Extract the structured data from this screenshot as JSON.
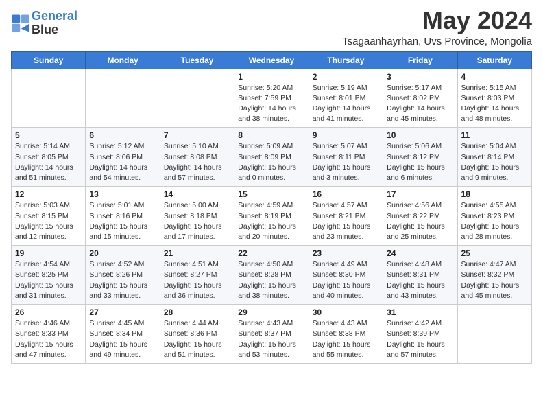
{
  "header": {
    "logo_line1": "General",
    "logo_line2": "Blue",
    "month": "May 2024",
    "location": "Tsagaanhayrhan, Uvs Province, Mongolia"
  },
  "weekdays": [
    "Sunday",
    "Monday",
    "Tuesday",
    "Wednesday",
    "Thursday",
    "Friday",
    "Saturday"
  ],
  "weeks": [
    [
      {
        "day": "",
        "info": ""
      },
      {
        "day": "",
        "info": ""
      },
      {
        "day": "",
        "info": ""
      },
      {
        "day": "1",
        "info": "Sunrise: 5:20 AM\nSunset: 7:59 PM\nDaylight: 14 hours\nand 38 minutes."
      },
      {
        "day": "2",
        "info": "Sunrise: 5:19 AM\nSunset: 8:01 PM\nDaylight: 14 hours\nand 41 minutes."
      },
      {
        "day": "3",
        "info": "Sunrise: 5:17 AM\nSunset: 8:02 PM\nDaylight: 14 hours\nand 45 minutes."
      },
      {
        "day": "4",
        "info": "Sunrise: 5:15 AM\nSunset: 8:03 PM\nDaylight: 14 hours\nand 48 minutes."
      }
    ],
    [
      {
        "day": "5",
        "info": "Sunrise: 5:14 AM\nSunset: 8:05 PM\nDaylight: 14 hours\nand 51 minutes."
      },
      {
        "day": "6",
        "info": "Sunrise: 5:12 AM\nSunset: 8:06 PM\nDaylight: 14 hours\nand 54 minutes."
      },
      {
        "day": "7",
        "info": "Sunrise: 5:10 AM\nSunset: 8:08 PM\nDaylight: 14 hours\nand 57 minutes."
      },
      {
        "day": "8",
        "info": "Sunrise: 5:09 AM\nSunset: 8:09 PM\nDaylight: 15 hours\nand 0 minutes."
      },
      {
        "day": "9",
        "info": "Sunrise: 5:07 AM\nSunset: 8:11 PM\nDaylight: 15 hours\nand 3 minutes."
      },
      {
        "day": "10",
        "info": "Sunrise: 5:06 AM\nSunset: 8:12 PM\nDaylight: 15 hours\nand 6 minutes."
      },
      {
        "day": "11",
        "info": "Sunrise: 5:04 AM\nSunset: 8:14 PM\nDaylight: 15 hours\nand 9 minutes."
      }
    ],
    [
      {
        "day": "12",
        "info": "Sunrise: 5:03 AM\nSunset: 8:15 PM\nDaylight: 15 hours\nand 12 minutes."
      },
      {
        "day": "13",
        "info": "Sunrise: 5:01 AM\nSunset: 8:16 PM\nDaylight: 15 hours\nand 15 minutes."
      },
      {
        "day": "14",
        "info": "Sunrise: 5:00 AM\nSunset: 8:18 PM\nDaylight: 15 hours\nand 17 minutes."
      },
      {
        "day": "15",
        "info": "Sunrise: 4:59 AM\nSunset: 8:19 PM\nDaylight: 15 hours\nand 20 minutes."
      },
      {
        "day": "16",
        "info": "Sunrise: 4:57 AM\nSunset: 8:21 PM\nDaylight: 15 hours\nand 23 minutes."
      },
      {
        "day": "17",
        "info": "Sunrise: 4:56 AM\nSunset: 8:22 PM\nDaylight: 15 hours\nand 25 minutes."
      },
      {
        "day": "18",
        "info": "Sunrise: 4:55 AM\nSunset: 8:23 PM\nDaylight: 15 hours\nand 28 minutes."
      }
    ],
    [
      {
        "day": "19",
        "info": "Sunrise: 4:54 AM\nSunset: 8:25 PM\nDaylight: 15 hours\nand 31 minutes."
      },
      {
        "day": "20",
        "info": "Sunrise: 4:52 AM\nSunset: 8:26 PM\nDaylight: 15 hours\nand 33 minutes."
      },
      {
        "day": "21",
        "info": "Sunrise: 4:51 AM\nSunset: 8:27 PM\nDaylight: 15 hours\nand 36 minutes."
      },
      {
        "day": "22",
        "info": "Sunrise: 4:50 AM\nSunset: 8:28 PM\nDaylight: 15 hours\nand 38 minutes."
      },
      {
        "day": "23",
        "info": "Sunrise: 4:49 AM\nSunset: 8:30 PM\nDaylight: 15 hours\nand 40 minutes."
      },
      {
        "day": "24",
        "info": "Sunrise: 4:48 AM\nSunset: 8:31 PM\nDaylight: 15 hours\nand 43 minutes."
      },
      {
        "day": "25",
        "info": "Sunrise: 4:47 AM\nSunset: 8:32 PM\nDaylight: 15 hours\nand 45 minutes."
      }
    ],
    [
      {
        "day": "26",
        "info": "Sunrise: 4:46 AM\nSunset: 8:33 PM\nDaylight: 15 hours\nand 47 minutes."
      },
      {
        "day": "27",
        "info": "Sunrise: 4:45 AM\nSunset: 8:34 PM\nDaylight: 15 hours\nand 49 minutes."
      },
      {
        "day": "28",
        "info": "Sunrise: 4:44 AM\nSunset: 8:36 PM\nDaylight: 15 hours\nand 51 minutes."
      },
      {
        "day": "29",
        "info": "Sunrise: 4:43 AM\nSunset: 8:37 PM\nDaylight: 15 hours\nand 53 minutes."
      },
      {
        "day": "30",
        "info": "Sunrise: 4:43 AM\nSunset: 8:38 PM\nDaylight: 15 hours\nand 55 minutes."
      },
      {
        "day": "31",
        "info": "Sunrise: 4:42 AM\nSunset: 8:39 PM\nDaylight: 15 hours\nand 57 minutes."
      },
      {
        "day": "",
        "info": ""
      }
    ]
  ]
}
